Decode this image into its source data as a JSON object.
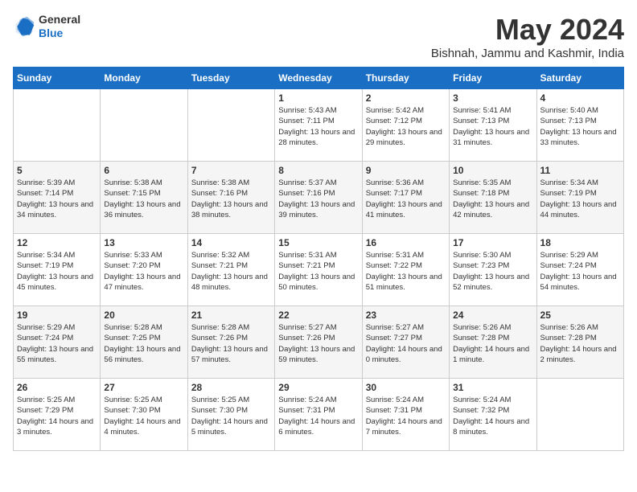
{
  "header": {
    "logo_general": "General",
    "logo_blue": "Blue",
    "month_title": "May 2024",
    "location": "Bishnah, Jammu and Kashmir, India"
  },
  "days_of_week": [
    "Sunday",
    "Monday",
    "Tuesday",
    "Wednesday",
    "Thursday",
    "Friday",
    "Saturday"
  ],
  "weeks": [
    [
      {
        "day": "",
        "info": ""
      },
      {
        "day": "",
        "info": ""
      },
      {
        "day": "",
        "info": ""
      },
      {
        "day": "1",
        "info": "Sunrise: 5:43 AM\nSunset: 7:11 PM\nDaylight: 13 hours\nand 28 minutes."
      },
      {
        "day": "2",
        "info": "Sunrise: 5:42 AM\nSunset: 7:12 PM\nDaylight: 13 hours\nand 29 minutes."
      },
      {
        "day": "3",
        "info": "Sunrise: 5:41 AM\nSunset: 7:13 PM\nDaylight: 13 hours\nand 31 minutes."
      },
      {
        "day": "4",
        "info": "Sunrise: 5:40 AM\nSunset: 7:13 PM\nDaylight: 13 hours\nand 33 minutes."
      }
    ],
    [
      {
        "day": "5",
        "info": "Sunrise: 5:39 AM\nSunset: 7:14 PM\nDaylight: 13 hours\nand 34 minutes."
      },
      {
        "day": "6",
        "info": "Sunrise: 5:38 AM\nSunset: 7:15 PM\nDaylight: 13 hours\nand 36 minutes."
      },
      {
        "day": "7",
        "info": "Sunrise: 5:38 AM\nSunset: 7:16 PM\nDaylight: 13 hours\nand 38 minutes."
      },
      {
        "day": "8",
        "info": "Sunrise: 5:37 AM\nSunset: 7:16 PM\nDaylight: 13 hours\nand 39 minutes."
      },
      {
        "day": "9",
        "info": "Sunrise: 5:36 AM\nSunset: 7:17 PM\nDaylight: 13 hours\nand 41 minutes."
      },
      {
        "day": "10",
        "info": "Sunrise: 5:35 AM\nSunset: 7:18 PM\nDaylight: 13 hours\nand 42 minutes."
      },
      {
        "day": "11",
        "info": "Sunrise: 5:34 AM\nSunset: 7:19 PM\nDaylight: 13 hours\nand 44 minutes."
      }
    ],
    [
      {
        "day": "12",
        "info": "Sunrise: 5:34 AM\nSunset: 7:19 PM\nDaylight: 13 hours\nand 45 minutes."
      },
      {
        "day": "13",
        "info": "Sunrise: 5:33 AM\nSunset: 7:20 PM\nDaylight: 13 hours\nand 47 minutes."
      },
      {
        "day": "14",
        "info": "Sunrise: 5:32 AM\nSunset: 7:21 PM\nDaylight: 13 hours\nand 48 minutes."
      },
      {
        "day": "15",
        "info": "Sunrise: 5:31 AM\nSunset: 7:21 PM\nDaylight: 13 hours\nand 50 minutes."
      },
      {
        "day": "16",
        "info": "Sunrise: 5:31 AM\nSunset: 7:22 PM\nDaylight: 13 hours\nand 51 minutes."
      },
      {
        "day": "17",
        "info": "Sunrise: 5:30 AM\nSunset: 7:23 PM\nDaylight: 13 hours\nand 52 minutes."
      },
      {
        "day": "18",
        "info": "Sunrise: 5:29 AM\nSunset: 7:24 PM\nDaylight: 13 hours\nand 54 minutes."
      }
    ],
    [
      {
        "day": "19",
        "info": "Sunrise: 5:29 AM\nSunset: 7:24 PM\nDaylight: 13 hours\nand 55 minutes."
      },
      {
        "day": "20",
        "info": "Sunrise: 5:28 AM\nSunset: 7:25 PM\nDaylight: 13 hours\nand 56 minutes."
      },
      {
        "day": "21",
        "info": "Sunrise: 5:28 AM\nSunset: 7:26 PM\nDaylight: 13 hours\nand 57 minutes."
      },
      {
        "day": "22",
        "info": "Sunrise: 5:27 AM\nSunset: 7:26 PM\nDaylight: 13 hours\nand 59 minutes."
      },
      {
        "day": "23",
        "info": "Sunrise: 5:27 AM\nSunset: 7:27 PM\nDaylight: 14 hours\nand 0 minutes."
      },
      {
        "day": "24",
        "info": "Sunrise: 5:26 AM\nSunset: 7:28 PM\nDaylight: 14 hours\nand 1 minute."
      },
      {
        "day": "25",
        "info": "Sunrise: 5:26 AM\nSunset: 7:28 PM\nDaylight: 14 hours\nand 2 minutes."
      }
    ],
    [
      {
        "day": "26",
        "info": "Sunrise: 5:25 AM\nSunset: 7:29 PM\nDaylight: 14 hours\nand 3 minutes."
      },
      {
        "day": "27",
        "info": "Sunrise: 5:25 AM\nSunset: 7:30 PM\nDaylight: 14 hours\nand 4 minutes."
      },
      {
        "day": "28",
        "info": "Sunrise: 5:25 AM\nSunset: 7:30 PM\nDaylight: 14 hours\nand 5 minutes."
      },
      {
        "day": "29",
        "info": "Sunrise: 5:24 AM\nSunset: 7:31 PM\nDaylight: 14 hours\nand 6 minutes."
      },
      {
        "day": "30",
        "info": "Sunrise: 5:24 AM\nSunset: 7:31 PM\nDaylight: 14 hours\nand 7 minutes."
      },
      {
        "day": "31",
        "info": "Sunrise: 5:24 AM\nSunset: 7:32 PM\nDaylight: 14 hours\nand 8 minutes."
      },
      {
        "day": "",
        "info": ""
      }
    ]
  ]
}
